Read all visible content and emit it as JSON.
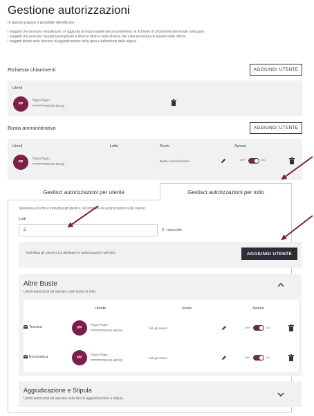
{
  "page": {
    "title": "Gestione autorizzazioni",
    "subtitle": "In questa pagina è possibile identificare:",
    "bullets": [
      "I soggetti che possono visualizzare, in aggiunta al responsabile del procedimento, le richieste di chiarimenti pervenute sulla gara",
      "I soggetti che possono visualizzare/operare a diverso titolo e nelle diverse fasi sulla procedura di esame delle offerte",
      "I soggetti titolari delle funzioni di aggiudicazione della gara e definizione della stipula"
    ]
  },
  "chiarimenti": {
    "title": "Richiesta chiarimenti",
    "add_label": "AGGIUNGI UTENTE",
    "col_utenti": "Utenti",
    "user": {
      "initials": "PP",
      "name": "Pippo Pippo",
      "code": "PPPPPP80A01H501Q"
    }
  },
  "busta": {
    "title": "Busta amministrativa",
    "add_label": "AGGIUNGI UTENTE",
    "cols": {
      "utenti": "Utenti",
      "lotto": "Lotto",
      "ruolo": "Ruolo",
      "azione": "Azione"
    },
    "user": {
      "initials": "PP",
      "name": "Pippo Pippo",
      "code": "PPPPPP80A01H501Q",
      "ruolo": "Busta Amministrativa",
      "off": "OFF",
      "on": "ON"
    }
  },
  "tabs": {
    "per_utente": "Gestisci autorizzazioni per utente",
    "per_lotto": "Gestisci autorizzazioni per lotto"
  },
  "lotto_panel": {
    "instruction": "Seleziona un lotto e individua gli utenti a cui attribuire le autorizzazioni sullo stesso.",
    "lotti_label": "Lotti",
    "lotto_value": "2",
    "lotto_name": "2 - secondo",
    "individua_text": "Individua gli utenti a cui attribuire le autorizzazioni sul lotto",
    "add_label": "AGGIUNGI UTENTE"
  },
  "altre_buste": {
    "title": "Altre Buste",
    "subtitle": "Utenti autorizzati ad operare sulle buste di lotto",
    "cols": {
      "utente": "Utente",
      "ruolo": "Ruolo",
      "azione": "Azione"
    },
    "rows": [
      {
        "busta": "Tecnica",
        "initials": "PP",
        "name": "Pippo Pippo",
        "code": "PPPPPP80A01H501Q",
        "ruolo": "tutti gli esami",
        "off": "OFF",
        "on": "ON"
      },
      {
        "busta": "Economica",
        "initials": "PP",
        "name": "Pippo Pippo",
        "code": "PPPPPP80A01H501Q",
        "ruolo": "tutti gli esami",
        "off": "OFF",
        "on": "ON"
      }
    ]
  },
  "aggiudicazione": {
    "title": "Aggiudicazione e Stipula",
    "subtitle": "Utenti autorizzati ad operare nelle fasi di aggiudicazione e stipula"
  },
  "colors": {
    "accent": "#7d1f48",
    "toggle": "#6d2b53",
    "arrow": "#7a2048",
    "dark_button": "#2a2f36"
  }
}
